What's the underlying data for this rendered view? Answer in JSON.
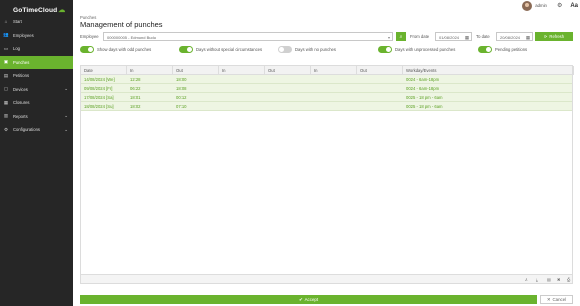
{
  "app": {
    "logo": "GoTimeCloud"
  },
  "sidebar": {
    "items": [
      {
        "label": "Start",
        "icon": "home-icon",
        "glyph": "⌂",
        "active": false,
        "expandable": false
      },
      {
        "label": "Employees",
        "icon": "users-icon",
        "glyph": "👥",
        "active": false,
        "expandable": false
      },
      {
        "label": "Log",
        "icon": "log-icon",
        "glyph": "▭",
        "active": false,
        "expandable": false
      },
      {
        "label": "Punches",
        "icon": "punches-icon",
        "glyph": "▣",
        "active": true,
        "expandable": false
      },
      {
        "label": "Petitions",
        "icon": "petitions-icon",
        "glyph": "▤",
        "active": false,
        "expandable": false
      },
      {
        "label": "Devices",
        "icon": "devices-icon",
        "glyph": "▢",
        "active": false,
        "expandable": true
      },
      {
        "label": "Closures",
        "icon": "closures-icon",
        "glyph": "▦",
        "active": false,
        "expandable": false
      },
      {
        "label": "Reports",
        "icon": "reports-icon",
        "glyph": "▥",
        "active": false,
        "expandable": true
      },
      {
        "label": "Configurations",
        "icon": "gear-icon",
        "glyph": "⚙",
        "active": false,
        "expandable": true
      }
    ]
  },
  "topbar": {
    "user": "admin",
    "lang": "Aa"
  },
  "breadcrumb": "Punches",
  "title": "Management of punches",
  "filters": {
    "employee_label": "Employee",
    "employee_value": "000000005 - Edmund Budu",
    "from_label": "From date",
    "from_value": "01/08/2024",
    "to_label": "To date",
    "to_value": "20/08/2024",
    "refresh_label": "Refresh"
  },
  "toggles": [
    {
      "label": "Show days with odd punches",
      "on": true
    },
    {
      "label": "Days without special circumstances",
      "on": true
    },
    {
      "label": "Days with no punches",
      "on": false
    },
    {
      "label": "Days with unprocessed punches",
      "on": true
    },
    {
      "label": "Pending petitions",
      "on": true
    }
  ],
  "table": {
    "columns": [
      "Date",
      "In",
      "Out",
      "In",
      "Out",
      "In",
      "Out",
      "Workday/Events"
    ],
    "rows": [
      {
        "date": "14/08/2024 [We]",
        "in1": "12:28",
        "out1": "18:00",
        "in2": "",
        "out2": "",
        "in3": "",
        "out3": "",
        "workday": "0024 - 6am-18pm"
      },
      {
        "date": "09/08/2024 [Fr]",
        "in1": "06:22",
        "out1": "18:08",
        "in2": "",
        "out2": "",
        "in3": "",
        "out3": "",
        "workday": "0024 - 6am-18pm"
      },
      {
        "date": "17/08/2024 [Sa]",
        "in1": "18:01",
        "out1": "00:12",
        "in2": "",
        "out2": "",
        "in3": "",
        "out3": "",
        "workday": "0025 - 18 pm - 6am"
      },
      {
        "date": "18/08/2024 [Su]",
        "in1": "18:02",
        "out1": "07:10",
        "in2": "",
        "out2": "",
        "in3": "",
        "out3": "",
        "workday": "0025 - 18 pm - 6am"
      }
    ]
  },
  "actions": {
    "accept_label": "Accept",
    "cancel_label": "Cancel"
  },
  "colors": {
    "accent": "#6ab32e",
    "sidebar_bg": "#262626",
    "row_bg": "#eef5e3"
  }
}
